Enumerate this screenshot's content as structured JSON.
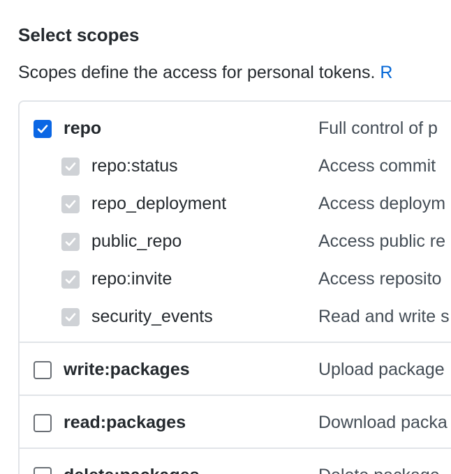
{
  "section": {
    "title": "Select scopes",
    "description": "Scopes define the access for personal tokens.",
    "link_text": "R"
  },
  "scopes": [
    {
      "name": "repo",
      "description": "Full control of p",
      "state": "checked"
    },
    {
      "name": "repo:status",
      "description": "Access commit",
      "state": "checked-disabled"
    },
    {
      "name": "repo_deployment",
      "description": "Access deploym",
      "state": "checked-disabled"
    },
    {
      "name": "public_repo",
      "description": "Access public re",
      "state": "checked-disabled"
    },
    {
      "name": "repo:invite",
      "description": "Access reposito",
      "state": "checked-disabled"
    },
    {
      "name": "security_events",
      "description": "Read and write s",
      "state": "checked-disabled"
    },
    {
      "name": "write:packages",
      "description": "Upload package",
      "state": "unchecked"
    },
    {
      "name": "read:packages",
      "description": "Download packa",
      "state": "unchecked"
    },
    {
      "name": "delete:packages",
      "description": "Delete package",
      "state": "unchecked"
    }
  ],
  "icons": {
    "checkbox_checked": "checkmark-icon"
  },
  "colors": {
    "accent": "#0a66e4",
    "link": "#0366d6",
    "disabled_check": "#cfd2d6",
    "border": "#e1e4e8"
  }
}
